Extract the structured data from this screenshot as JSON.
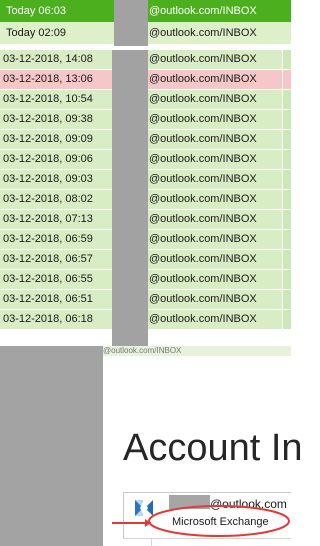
{
  "top_rows": [
    {
      "time": "Today 06:03",
      "folder": "@outlook.com/INBOX"
    },
    {
      "time": "Today 02:09",
      "folder": "@outlook.com/INBOX"
    }
  ],
  "rows": [
    {
      "time": "03-12-2018, 14:08",
      "folder": "@outlook.com/INBOX",
      "state": "normal"
    },
    {
      "time": "03-12-2018, 13:06",
      "folder": "@outlook.com/INBOX",
      "state": "highlighted"
    },
    {
      "time": "03-12-2018, 10:54",
      "folder": "@outlook.com/INBOX",
      "state": "normal"
    },
    {
      "time": "03-12-2018, 09:38",
      "folder": "@outlook.com/INBOX",
      "state": "normal"
    },
    {
      "time": "03-12-2018, 09:09",
      "folder": "@outlook.com/INBOX",
      "state": "normal"
    },
    {
      "time": "03-12-2018, 09:06",
      "folder": "@outlook.com/INBOX",
      "state": "normal"
    },
    {
      "time": "03-12-2018, 09:03",
      "folder": "@outlook.com/INBOX",
      "state": "normal"
    },
    {
      "time": "03-12-2018, 08:02",
      "folder": "@outlook.com/INBOX",
      "state": "normal"
    },
    {
      "time": "03-12-2018, 07:13",
      "folder": "@outlook.com/INBOX",
      "state": "normal"
    },
    {
      "time": "03-12-2018, 06:59",
      "folder": "@outlook.com/INBOX",
      "state": "normal"
    },
    {
      "time": "03-12-2018, 06:57",
      "folder": "@outlook.com/INBOX",
      "state": "normal"
    },
    {
      "time": "03-12-2018, 06:55",
      "folder": "@outlook.com/INBOX",
      "state": "normal"
    },
    {
      "time": "03-12-2018, 06:51",
      "folder": "@outlook.com/INBOX",
      "state": "normal"
    },
    {
      "time": "03-12-2018, 06:18",
      "folder": "@outlook.com/INBOX",
      "state": "normal"
    }
  ],
  "partial_row_text": "@outlook.com/INBOX",
  "account": {
    "title": "Account In",
    "email_domain": "@outlook.com",
    "type": "Microsoft Exchange",
    "icon_name": "exchange-server-icon"
  },
  "colors": {
    "top_selected": "#4caf1e",
    "top_light": "#ddf0c8",
    "row_normal_a": "#d8edc4",
    "row_normal_b": "#d8edc4",
    "row_highlight": "#f6c7c9",
    "row_tail": "#cde8b8",
    "redaction": "#a2a2a2",
    "annotation": "#e53935"
  }
}
